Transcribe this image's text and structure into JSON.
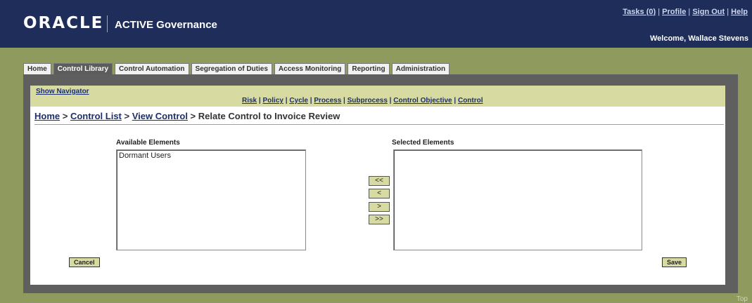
{
  "header": {
    "logo": "ORACLE",
    "product": "ACTIVE Governance",
    "links": [
      "Tasks (0)",
      "Profile",
      "Sign Out",
      "Help"
    ],
    "welcome": "Welcome, Wallace Stevens"
  },
  "tabs": [
    "Home",
    "Control Library",
    "Control Automation",
    "Segregation of Duties",
    "Access Monitoring",
    "Reporting",
    "Administration"
  ],
  "active_tab": "Control Library",
  "subnav": {
    "show_navigator": "Show Navigator",
    "filters": [
      "Risk",
      "Policy",
      "Cycle",
      "Process",
      "Subprocess",
      "Control Objective",
      "Control"
    ]
  },
  "breadcrumb": {
    "home": "Home",
    "control_list": "Control List",
    "view_control": "View Control",
    "current": "Relate Control to Invoice Review",
    "sep": " > "
  },
  "available": {
    "label": "Available Elements",
    "items": [
      "Dormant Users"
    ]
  },
  "selected": {
    "label": "Selected Elements",
    "items": []
  },
  "move_buttons": {
    "all_left": "<<",
    "left": "<",
    "right": ">",
    "all_right": ">>"
  },
  "actions": {
    "cancel": "Cancel",
    "save": "Save"
  },
  "footer": {
    "top_link": "Top"
  }
}
